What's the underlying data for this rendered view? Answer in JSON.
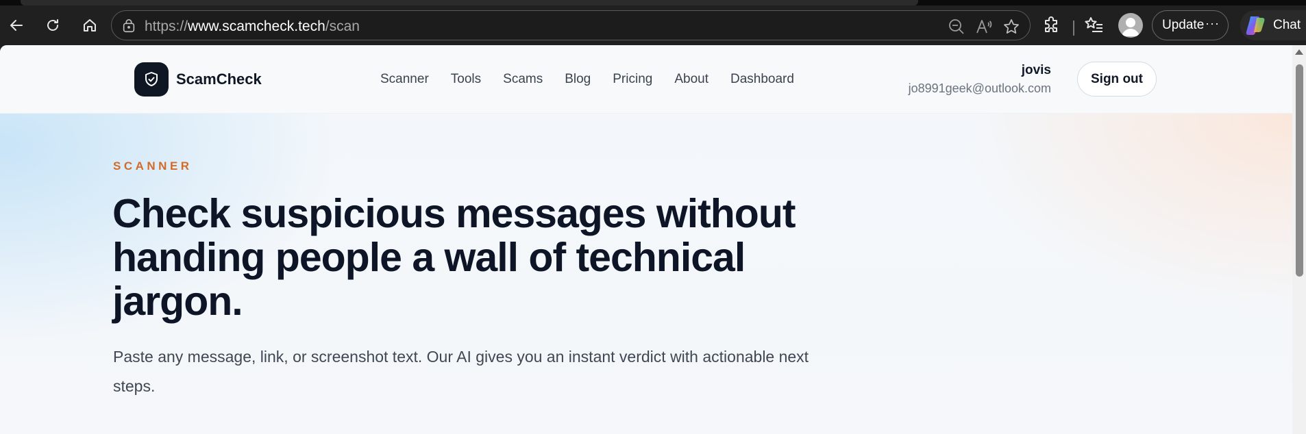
{
  "browser": {
    "url_prefix": "https://",
    "url_domain": "www.scamcheck.tech",
    "url_path": "/scan",
    "update_label": "Update",
    "update_more": "···",
    "copilot_label": "Chat",
    "icons": [
      "back-arrow-icon",
      "refresh-icon",
      "home-icon",
      "lock-icon",
      "zoom-out-icon",
      "read-aloud-icon",
      "favorite-star-icon",
      "extensions-icon",
      "favorites-list-icon",
      "profile-avatar-icon",
      "copilot-icon"
    ]
  },
  "site": {
    "logo_text": "ScamCheck",
    "nav": [
      "Scanner",
      "Tools",
      "Scams",
      "Blog",
      "Pricing",
      "About",
      "Dashboard"
    ],
    "user": {
      "name": "jovis",
      "email": "jo8991geek@outlook.com"
    },
    "signout_label": "Sign out"
  },
  "hero": {
    "eyebrow": "SCANNER",
    "title": "Check suspicious messages without handing people a wall of technical jargon.",
    "subtitle": "Paste any message, link, or screenshot text. Our AI gives you an instant verdict with actionable next steps."
  },
  "colors": {
    "accent": "#d46a2a",
    "heading": "#0d1526",
    "logo_bg": "#0f1725",
    "chrome_bg": "#202020"
  }
}
